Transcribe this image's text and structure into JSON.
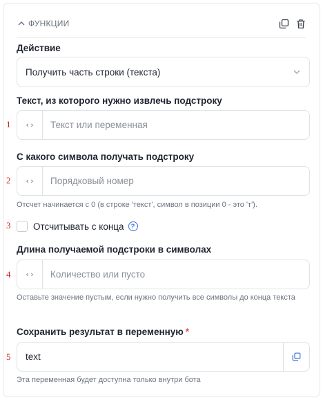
{
  "section": {
    "title": "ФУНКЦИИ",
    "icons": {
      "collapse": "chevron-up-icon",
      "copy": "copy-icon",
      "delete": "trash-icon"
    }
  },
  "action": {
    "label": "Действие",
    "value": "Получить часть строки (текста)"
  },
  "source_text": {
    "number": "1",
    "label": "Текст, из которого нужно извлечь подстроку",
    "prefix": "‹›",
    "placeholder": "Текст или переменная"
  },
  "start_char": {
    "number": "2",
    "label": "С какого символа получать подстроку",
    "prefix": "‹›",
    "placeholder": "Порядковый номер",
    "hint": "Отсчет начинается с 0 (в строке 'текст', символ в позиции 0 - это 'т')."
  },
  "count_from_end": {
    "number": "3",
    "label": "Отсчитывать с конца",
    "checked": false,
    "help": "?"
  },
  "length": {
    "number": "4",
    "label": "Длина получаемой подстроки в символах",
    "prefix": "‹›",
    "placeholder": "Количество или пусто",
    "hint": "Оставьте значение пустым, если нужно получить все символы до конца текста"
  },
  "result_var": {
    "number": "5",
    "label": "Сохранить результат в переменную",
    "required_mark": "*",
    "value": "text",
    "hint": "Эта переменная будет доступна только внутри бота"
  },
  "colors": {
    "accent": "#3b6fd8",
    "required": "#e5484d",
    "annotation": "#cc2020"
  }
}
